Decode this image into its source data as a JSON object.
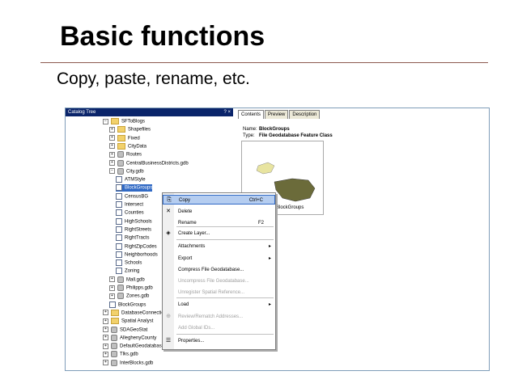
{
  "slide": {
    "title": "Basic functions",
    "subtitle": "Copy, paste, rename, etc."
  },
  "catalog": {
    "title": "Catalog Tree",
    "title_buttons": "? ×",
    "rows": [
      {
        "label": "SFToBlogs",
        "icon": "folder-icon",
        "expander": "−",
        "indent": 0
      },
      {
        "label": "Shapefiles",
        "icon": "folder-icon",
        "expander": "+",
        "indent": 1
      },
      {
        "label": "Fixed",
        "icon": "folder-icon",
        "expander": "+",
        "indent": 1
      },
      {
        "label": "CityData",
        "icon": "folder-icon",
        "expander": "+",
        "indent": 1
      },
      {
        "label": "Routes",
        "icon": "gdb-icon",
        "expander": "+",
        "indent": 1
      },
      {
        "label": "CentralBusinessDistricts.gdb",
        "icon": "gdb-icon",
        "expander": "+",
        "indent": 1
      },
      {
        "label": "City.gdb",
        "icon": "gdb-icon",
        "expander": "−",
        "indent": 1
      },
      {
        "label": "ATMStyle",
        "icon": "fc-icon",
        "expander": "",
        "indent": 2
      },
      {
        "label": "BlockGroups",
        "icon": "fc-icon",
        "expander": "",
        "indent": 2,
        "selected": true
      },
      {
        "label": "CensusBG",
        "icon": "fc-icon",
        "expander": "",
        "indent": 2
      },
      {
        "label": "Intersect",
        "icon": "fc-icon",
        "expander": "",
        "indent": 2
      },
      {
        "label": "Counties",
        "icon": "fc-icon",
        "expander": "",
        "indent": 2
      },
      {
        "label": "HighSchools",
        "icon": "fc-icon",
        "expander": "",
        "indent": 2
      },
      {
        "label": "RightStreets",
        "icon": "fc-icon",
        "expander": "",
        "indent": 2
      },
      {
        "label": "RightTracts",
        "icon": "fc-icon",
        "expander": "",
        "indent": 2
      },
      {
        "label": "RightZipCodes",
        "icon": "fc-icon",
        "expander": "",
        "indent": 2
      },
      {
        "label": "Neighborhoods",
        "icon": "fc-icon",
        "expander": "",
        "indent": 2
      },
      {
        "label": "Schools",
        "icon": "fc-icon",
        "expander": "",
        "indent": 2
      },
      {
        "label": "Zoning",
        "icon": "fc-icon",
        "expander": "",
        "indent": 2
      },
      {
        "label": "Mall.gdb",
        "icon": "gdb-icon",
        "expander": "+",
        "indent": 1
      },
      {
        "label": "Philipps.gdb",
        "icon": "gdb-icon",
        "expander": "+",
        "indent": 1
      },
      {
        "label": "Zones.gdb",
        "icon": "gdb-icon",
        "expander": "+",
        "indent": 1
      },
      {
        "label": "BlockGroups",
        "icon": "fc-icon",
        "expander": "",
        "indent": 1
      },
      {
        "label": "DatabaseConnections",
        "icon": "folder-icon",
        "expander": "+",
        "indent": 0
      },
      {
        "label": "Spatial Analyst",
        "icon": "folder-icon",
        "expander": "+",
        "indent": 0
      },
      {
        "label": "SDAGeoStat",
        "icon": "gdb-icon",
        "expander": "+",
        "indent": 0
      },
      {
        "label": "AlleghenyCounty",
        "icon": "gdb-icon",
        "expander": "+",
        "indent": 0
      },
      {
        "label": "DefaultGeodatabase",
        "icon": "gdb-icon",
        "expander": "+",
        "indent": 0
      },
      {
        "label": "Tlks.gdb",
        "icon": "gdb-icon",
        "expander": "+",
        "indent": 0
      },
      {
        "label": "InterBlocks.gdb",
        "icon": "gdb-icon",
        "expander": "+",
        "indent": 0
      }
    ]
  },
  "right": {
    "tabs": [
      "Contents",
      "Preview",
      "Description"
    ],
    "name_key": "Name:",
    "name_value": "BlockGroups",
    "type_key": "Type:",
    "type_value": "File Geodatabase Feature Class",
    "preview_label": "BlockGroups"
  },
  "context_menu": {
    "items": [
      {
        "label": "Copy",
        "shortcut": "Ctrl+C",
        "icon": "copy-icon",
        "glyph": "⎘",
        "highlighted": true
      },
      {
        "label": "Delete",
        "shortcut": "",
        "icon": "delete-icon",
        "glyph": "✕"
      },
      {
        "label": "Rename",
        "shortcut": "F2",
        "icon": "",
        "glyph": ""
      },
      {
        "label": "Create Layer...",
        "shortcut": "",
        "icon": "layer-icon",
        "glyph": "◈"
      },
      {
        "label": "Attachments",
        "shortcut": "",
        "arrow": "▸",
        "icon": "",
        "glyph": ""
      },
      {
        "label": "Export",
        "shortcut": "",
        "arrow": "▸",
        "icon": "",
        "glyph": ""
      },
      {
        "label": "Compress File Geodatabase...",
        "shortcut": "",
        "icon": "",
        "glyph": ""
      },
      {
        "label": "Uncompress File Geodatabase...",
        "shortcut": "",
        "icon": "",
        "glyph": "",
        "disabled": true
      },
      {
        "label": "Unregister Spatial Reference...",
        "shortcut": "",
        "icon": "",
        "glyph": "",
        "disabled": true
      },
      {
        "label": "Load",
        "shortcut": "",
        "arrow": "▸",
        "icon": "",
        "glyph": ""
      },
      {
        "label": "Review/Rematch Addresses...",
        "shortcut": "",
        "icon": "geocode-icon",
        "glyph": "⊕",
        "disabled": true
      },
      {
        "label": "Add Global IDs...",
        "shortcut": "",
        "icon": "",
        "glyph": "",
        "disabled": true
      },
      {
        "label": "Properties...",
        "shortcut": "",
        "icon": "properties-icon",
        "glyph": "☰"
      }
    ]
  },
  "colors": {
    "title_bar": "#0a246a",
    "selection": "#316ac5",
    "menu_highlight": "#b5cdf0",
    "rule": "#8c5a50"
  }
}
